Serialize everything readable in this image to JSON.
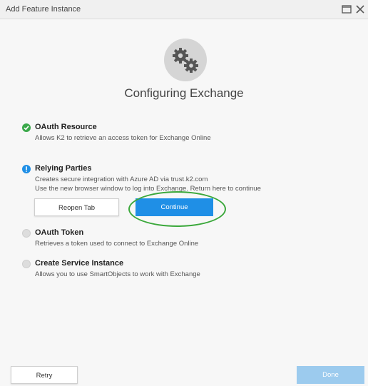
{
  "window": {
    "title": "Add Feature Instance"
  },
  "heading": "Configuring Exchange",
  "steps": [
    {
      "title": "OAuth Resource",
      "desc": "Allows K2 to retrieve an access token for Exchange Online",
      "status": "complete"
    },
    {
      "title": "Relying Parties",
      "desc_lines": [
        "Creates secure integration with Azure AD via trust.k2.com",
        "Use the new browser window to log into Exchange. Return here to continue"
      ],
      "status": "action-required"
    },
    {
      "title": "OAuth Token",
      "desc": "Retrieves a token used to connect to Exchange Online",
      "status": "pending"
    },
    {
      "title": "Create Service Instance",
      "desc": "Allows you to use SmartObjects to work with Exchange",
      "status": "pending"
    }
  ],
  "buttons": {
    "reopen_tab": "Reopen Tab",
    "continue": "Continue",
    "retry": "Retry",
    "done": "Done"
  },
  "colors": {
    "accent_blue": "#1f8fe6",
    "success_green": "#3aa84a",
    "highlight_ring": "#3ba83b"
  },
  "icons": {
    "header": "gears-icon",
    "complete": "check-circle-icon",
    "action": "exclamation-circle-icon",
    "pending": "empty-circle-icon"
  }
}
